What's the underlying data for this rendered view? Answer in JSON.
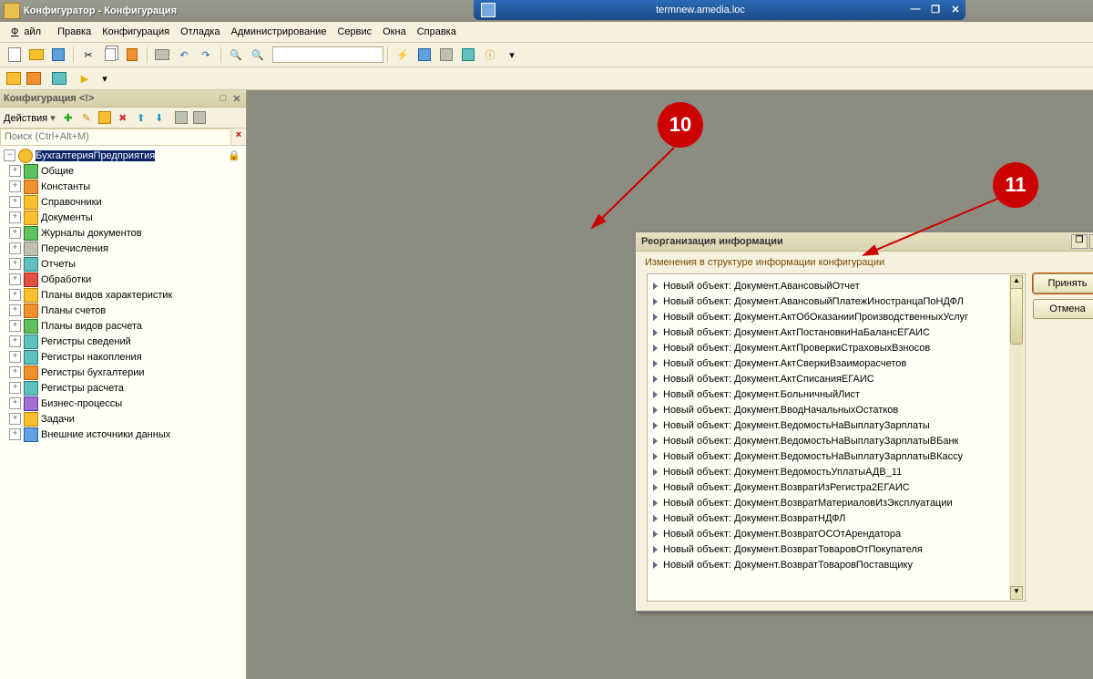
{
  "titlebar": {
    "text": "Конфигуратор - Конфигурация"
  },
  "remote": {
    "host": "termnew.amedia.loc"
  },
  "menu": {
    "file": "Файл",
    "edit": "Правка",
    "config": "Конфигурация",
    "debug": "Отладка",
    "admin": "Администрирование",
    "service": "Сервис",
    "windows": "Окна",
    "help": "Справка"
  },
  "panel": {
    "title": "Конфигурация <!>",
    "actions_label": "Действия",
    "search_placeholder": "Поиск (Ctrl+Alt+M)",
    "root": "БухгалтерияПредприятия",
    "items": [
      {
        "label": "Общие",
        "iconClass": "i-green"
      },
      {
        "label": "Константы",
        "iconClass": "i-orange"
      },
      {
        "label": "Справочники",
        "iconClass": "i-yellow"
      },
      {
        "label": "Документы",
        "iconClass": "i-yellow"
      },
      {
        "label": "Журналы документов",
        "iconClass": "i-green"
      },
      {
        "label": "Перечисления",
        "iconClass": "i-gray"
      },
      {
        "label": "Отчеты",
        "iconClass": "i-cyan"
      },
      {
        "label": "Обработки",
        "iconClass": "i-red"
      },
      {
        "label": "Планы видов характеристик",
        "iconClass": "i-yellow"
      },
      {
        "label": "Планы счетов",
        "iconClass": "i-orange"
      },
      {
        "label": "Планы видов расчета",
        "iconClass": "i-green"
      },
      {
        "label": "Регистры сведений",
        "iconClass": "i-cyan"
      },
      {
        "label": "Регистры накопления",
        "iconClass": "i-cyan"
      },
      {
        "label": "Регистры бухгалтерии",
        "iconClass": "i-orange"
      },
      {
        "label": "Регистры расчета",
        "iconClass": "i-cyan"
      },
      {
        "label": "Бизнес-процессы",
        "iconClass": "i-purple"
      },
      {
        "label": "Задачи",
        "iconClass": "i-yellow"
      },
      {
        "label": "Внешние источники данных",
        "iconClass": "i-blue"
      }
    ]
  },
  "dialog": {
    "title": "Реорганизация информации",
    "subtitle": "Изменения в структуре информации конфигурации",
    "accept": "Принять",
    "cancel": "Отмена",
    "prefix": "Новый объект: ",
    "items": [
      "Документ.АвансовыйОтчет",
      "Документ.АвансовыйПлатежИностранцаПоНДФЛ",
      "Документ.АктОбОказанииПроизводственныхУслуг",
      "Документ.АктПостановкиНаБалансЕГАИС",
      "Документ.АктПроверкиСтраховыхВзносов",
      "Документ.АктСверкиВзаиморасчетов",
      "Документ.АктСписанияЕГАИС",
      "Документ.БольничныйЛист",
      "Документ.ВводНачальныхОстатков",
      "Документ.ВедомостьНаВыплатуЗарплаты",
      "Документ.ВедомостьНаВыплатуЗарплатыВБанк",
      "Документ.ВедомостьНаВыплатуЗарплатыВКассу",
      "Документ.ВедомостьУплатыАДВ_11",
      "Документ.ВозвратИзРегистра2ЕГАИС",
      "Документ.ВозвратМатериаловИзЭксплуатации",
      "Документ.ВозвратНДФЛ",
      "Документ.ВозвратОСОтАрендатора",
      "Документ.ВозвратТоваровОтПокупателя",
      "Документ.ВозвратТоваровПоставщику"
    ]
  },
  "callouts": {
    "c10": "10",
    "c11": "11"
  }
}
